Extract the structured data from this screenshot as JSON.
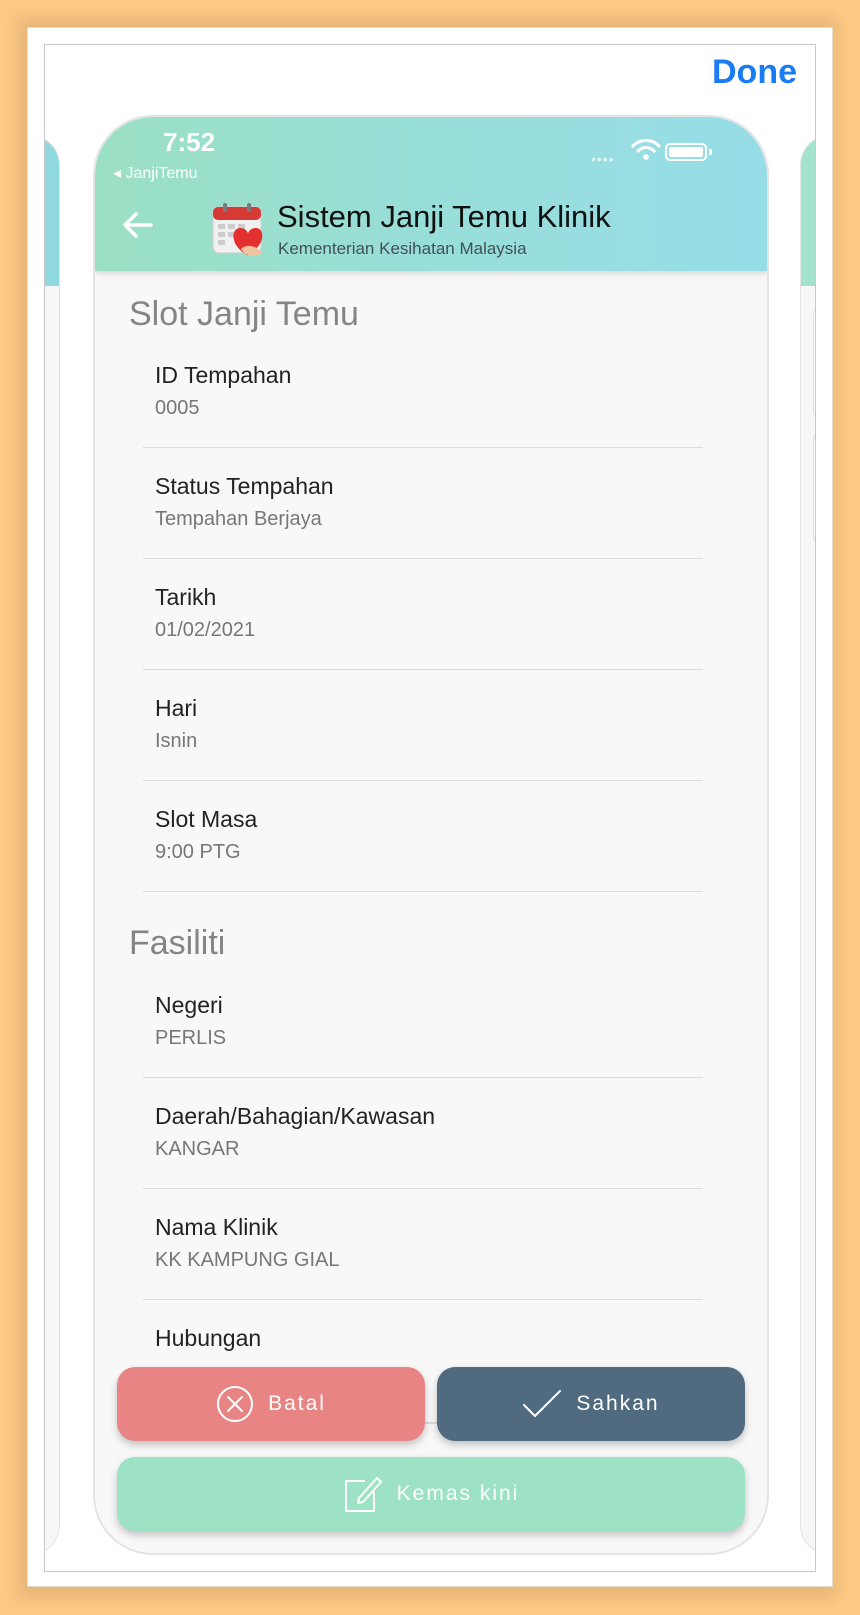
{
  "toolbar": {
    "done_label": "Done"
  },
  "status_bar": {
    "time": "7:52",
    "back_app": "◂ JanjiTemu",
    "dots": "••••"
  },
  "header": {
    "title": "Sistem Janji Temu Klinik",
    "subtitle": "Kementerian Kesihatan Malaysia"
  },
  "icons": {
    "back": "arrow-left-icon",
    "logo": "calendar-heart-icon",
    "batal": "circle-x-icon",
    "sahkan": "check-icon",
    "kemas": "edit-icon"
  },
  "sections": [
    {
      "title": "Slot Janji Temu",
      "items": [
        {
          "label": "ID Tempahan",
          "value": "0005"
        },
        {
          "label": "Status Tempahan",
          "value": "Tempahan Berjaya"
        },
        {
          "label": "Tarikh",
          "value": "01/02/2021"
        },
        {
          "label": "Hari",
          "value": "Isnin"
        },
        {
          "label": "Slot Masa",
          "value": "9:00 PTG"
        }
      ]
    },
    {
      "title": "Fasiliti",
      "items": [
        {
          "label": "Negeri",
          "value": "PERLIS"
        },
        {
          "label": "Daerah/Bahagian/Kawasan",
          "value": "KANGAR"
        },
        {
          "label": "Nama Klinik",
          "value": "KK KAMPUNG GIAL"
        },
        {
          "label": "Hubungan",
          "value": ""
        }
      ]
    }
  ],
  "actions": {
    "batal": "Batal",
    "sahkan": "Sahkan",
    "kemas_kini": "Kemas kini"
  },
  "colors": {
    "background": "#fec985",
    "done": "#1a7cf5",
    "batal": "#e88584",
    "sahkan": "#506b80",
    "kemas_kini": "#9de2c4"
  }
}
